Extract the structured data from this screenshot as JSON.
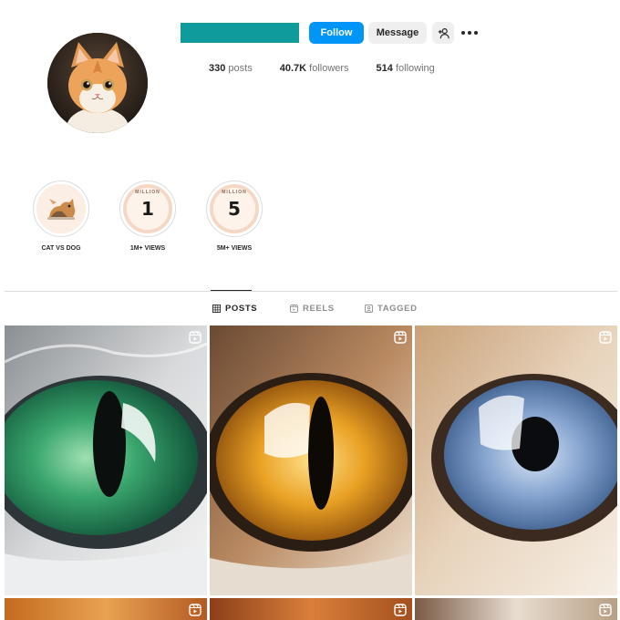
{
  "profile": {
    "avatar_icon": "kitten-avatar-icon",
    "username_bar_color": "#0f9a9b"
  },
  "header": {
    "follow_label": "Follow",
    "message_label": "Message",
    "add_user_icon": "add-user-icon",
    "more_icon": "more-options-icon"
  },
  "stats": {
    "posts_count": "330",
    "posts_label": "posts",
    "followers_count": "40.7K",
    "followers_label": "followers",
    "following_count": "514",
    "following_label": "following"
  },
  "highlights": [
    {
      "label": "CAT VS DOG",
      "badge": ""
    },
    {
      "label": "1M+ VIEWS",
      "badge": "1",
      "arc": "MILLION"
    },
    {
      "label": "5M+ VIEWS",
      "badge": "5",
      "arc": "MILLION"
    }
  ],
  "tabs": [
    {
      "label": "POSTS",
      "icon": "grid-icon",
      "active": true
    },
    {
      "label": "REELS",
      "icon": "reels-icon",
      "active": false
    },
    {
      "label": "TAGGED",
      "icon": "tagged-icon",
      "active": false
    }
  ],
  "posts": [
    {
      "type": "reel",
      "subject": "green cat eye",
      "iris_color": "#2f9a63"
    },
    {
      "type": "reel",
      "subject": "amber cat eye",
      "iris_color": "#e39a1c"
    },
    {
      "type": "reel",
      "subject": "blue cat eye",
      "iris_color": "#6f8fbf"
    },
    {
      "type": "reel",
      "subject": "orange fur",
      "iris_color": "#c46a1e"
    },
    {
      "type": "reel",
      "subject": "orange fur",
      "iris_color": "#b45b24"
    },
    {
      "type": "reel",
      "subject": "white fur",
      "iris_color": "#b79f85"
    }
  ],
  "colors": {
    "accent": "#0095f6",
    "secondary_button": "#efefef",
    "text": "#262626",
    "muted": "#737373"
  }
}
